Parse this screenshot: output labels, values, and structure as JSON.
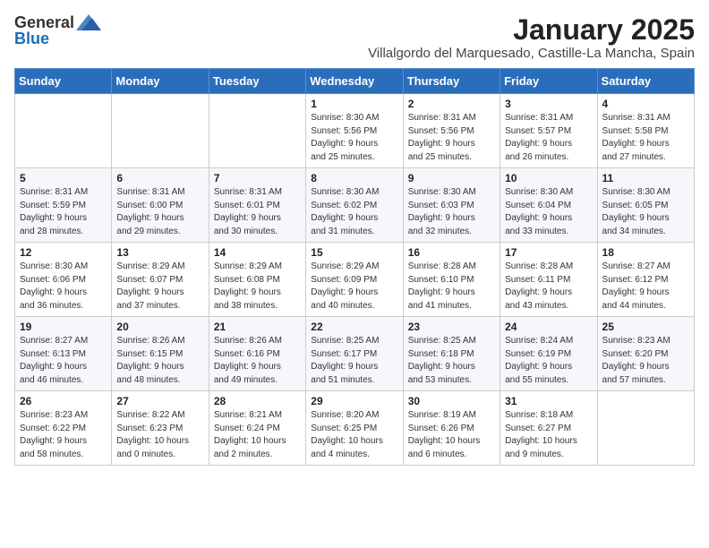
{
  "logo": {
    "general": "General",
    "blue": "Blue"
  },
  "title": "January 2025",
  "subtitle": "Villalgordo del Marquesado, Castille-La Mancha, Spain",
  "days_of_week": [
    "Sunday",
    "Monday",
    "Tuesday",
    "Wednesday",
    "Thursday",
    "Friday",
    "Saturday"
  ],
  "weeks": [
    [
      {
        "day": "",
        "info": ""
      },
      {
        "day": "",
        "info": ""
      },
      {
        "day": "",
        "info": ""
      },
      {
        "day": "1",
        "info": "Sunrise: 8:30 AM\nSunset: 5:56 PM\nDaylight: 9 hours\nand 25 minutes."
      },
      {
        "day": "2",
        "info": "Sunrise: 8:31 AM\nSunset: 5:56 PM\nDaylight: 9 hours\nand 25 minutes."
      },
      {
        "day": "3",
        "info": "Sunrise: 8:31 AM\nSunset: 5:57 PM\nDaylight: 9 hours\nand 26 minutes."
      },
      {
        "day": "4",
        "info": "Sunrise: 8:31 AM\nSunset: 5:58 PM\nDaylight: 9 hours\nand 27 minutes."
      }
    ],
    [
      {
        "day": "5",
        "info": "Sunrise: 8:31 AM\nSunset: 5:59 PM\nDaylight: 9 hours\nand 28 minutes."
      },
      {
        "day": "6",
        "info": "Sunrise: 8:31 AM\nSunset: 6:00 PM\nDaylight: 9 hours\nand 29 minutes."
      },
      {
        "day": "7",
        "info": "Sunrise: 8:31 AM\nSunset: 6:01 PM\nDaylight: 9 hours\nand 30 minutes."
      },
      {
        "day": "8",
        "info": "Sunrise: 8:30 AM\nSunset: 6:02 PM\nDaylight: 9 hours\nand 31 minutes."
      },
      {
        "day": "9",
        "info": "Sunrise: 8:30 AM\nSunset: 6:03 PM\nDaylight: 9 hours\nand 32 minutes."
      },
      {
        "day": "10",
        "info": "Sunrise: 8:30 AM\nSunset: 6:04 PM\nDaylight: 9 hours\nand 33 minutes."
      },
      {
        "day": "11",
        "info": "Sunrise: 8:30 AM\nSunset: 6:05 PM\nDaylight: 9 hours\nand 34 minutes."
      }
    ],
    [
      {
        "day": "12",
        "info": "Sunrise: 8:30 AM\nSunset: 6:06 PM\nDaylight: 9 hours\nand 36 minutes."
      },
      {
        "day": "13",
        "info": "Sunrise: 8:29 AM\nSunset: 6:07 PM\nDaylight: 9 hours\nand 37 minutes."
      },
      {
        "day": "14",
        "info": "Sunrise: 8:29 AM\nSunset: 6:08 PM\nDaylight: 9 hours\nand 38 minutes."
      },
      {
        "day": "15",
        "info": "Sunrise: 8:29 AM\nSunset: 6:09 PM\nDaylight: 9 hours\nand 40 minutes."
      },
      {
        "day": "16",
        "info": "Sunrise: 8:28 AM\nSunset: 6:10 PM\nDaylight: 9 hours\nand 41 minutes."
      },
      {
        "day": "17",
        "info": "Sunrise: 8:28 AM\nSunset: 6:11 PM\nDaylight: 9 hours\nand 43 minutes."
      },
      {
        "day": "18",
        "info": "Sunrise: 8:27 AM\nSunset: 6:12 PM\nDaylight: 9 hours\nand 44 minutes."
      }
    ],
    [
      {
        "day": "19",
        "info": "Sunrise: 8:27 AM\nSunset: 6:13 PM\nDaylight: 9 hours\nand 46 minutes."
      },
      {
        "day": "20",
        "info": "Sunrise: 8:26 AM\nSunset: 6:15 PM\nDaylight: 9 hours\nand 48 minutes."
      },
      {
        "day": "21",
        "info": "Sunrise: 8:26 AM\nSunset: 6:16 PM\nDaylight: 9 hours\nand 49 minutes."
      },
      {
        "day": "22",
        "info": "Sunrise: 8:25 AM\nSunset: 6:17 PM\nDaylight: 9 hours\nand 51 minutes."
      },
      {
        "day": "23",
        "info": "Sunrise: 8:25 AM\nSunset: 6:18 PM\nDaylight: 9 hours\nand 53 minutes."
      },
      {
        "day": "24",
        "info": "Sunrise: 8:24 AM\nSunset: 6:19 PM\nDaylight: 9 hours\nand 55 minutes."
      },
      {
        "day": "25",
        "info": "Sunrise: 8:23 AM\nSunset: 6:20 PM\nDaylight: 9 hours\nand 57 minutes."
      }
    ],
    [
      {
        "day": "26",
        "info": "Sunrise: 8:23 AM\nSunset: 6:22 PM\nDaylight: 9 hours\nand 58 minutes."
      },
      {
        "day": "27",
        "info": "Sunrise: 8:22 AM\nSunset: 6:23 PM\nDaylight: 10 hours\nand 0 minutes."
      },
      {
        "day": "28",
        "info": "Sunrise: 8:21 AM\nSunset: 6:24 PM\nDaylight: 10 hours\nand 2 minutes."
      },
      {
        "day": "29",
        "info": "Sunrise: 8:20 AM\nSunset: 6:25 PM\nDaylight: 10 hours\nand 4 minutes."
      },
      {
        "day": "30",
        "info": "Sunrise: 8:19 AM\nSunset: 6:26 PM\nDaylight: 10 hours\nand 6 minutes."
      },
      {
        "day": "31",
        "info": "Sunrise: 8:18 AM\nSunset: 6:27 PM\nDaylight: 10 hours\nand 9 minutes."
      },
      {
        "day": "",
        "info": ""
      }
    ]
  ]
}
